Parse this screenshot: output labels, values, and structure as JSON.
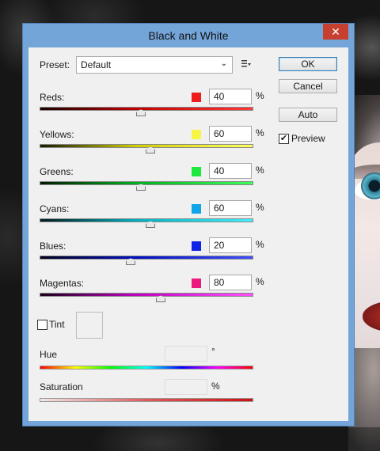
{
  "dialog": {
    "title": "Black and White",
    "close_symbol": "✕"
  },
  "preset": {
    "label": "Preset:",
    "value": "Default",
    "menu_icon": "preset-menu-icon"
  },
  "buttons": {
    "ok": "OK",
    "cancel": "Cancel",
    "auto": "Auto"
  },
  "preview": {
    "label": "Preview",
    "checked": true,
    "check_symbol": "✔"
  },
  "channels": [
    {
      "label": "Reds:",
      "value": "40",
      "unit": "%",
      "swatch": "#ee1c1c",
      "gradient": [
        "#1a0000",
        "#c00000",
        "#ff3a3a"
      ],
      "fraction": 0.476
    },
    {
      "label": "Yellows:",
      "value": "60",
      "unit": "%",
      "swatch": "#f9f545",
      "gradient": [
        "#1a1a00",
        "#cfcf00",
        "#ffff60"
      ],
      "fraction": 0.524
    },
    {
      "label": "Greens:",
      "value": "40",
      "unit": "%",
      "swatch": "#1de83c",
      "gradient": [
        "#001a00",
        "#00b020",
        "#3cff5a"
      ],
      "fraction": 0.476
    },
    {
      "label": "Cyans:",
      "value": "60",
      "unit": "%",
      "swatch": "#0fa5e6",
      "gradient": [
        "#001a1a",
        "#00b0c0",
        "#40f0ff"
      ],
      "fraction": 0.524
    },
    {
      "label": "Blues:",
      "value": "20",
      "unit": "%",
      "swatch": "#1024e6",
      "gradient": [
        "#00001a",
        "#0010c0",
        "#4050ff"
      ],
      "fraction": 0.429
    },
    {
      "label": "Magentas:",
      "value": "80",
      "unit": "%",
      "swatch": "#ec1a7d",
      "gradient": [
        "#1a001a",
        "#c000c0",
        "#ff50ff"
      ],
      "fraction": 0.571
    }
  ],
  "tint": {
    "label": "Tint",
    "checked": false
  },
  "hue": {
    "label": "Hue",
    "value": "",
    "unit": "°"
  },
  "saturation": {
    "label": "Saturation",
    "value": "",
    "unit": "%"
  }
}
